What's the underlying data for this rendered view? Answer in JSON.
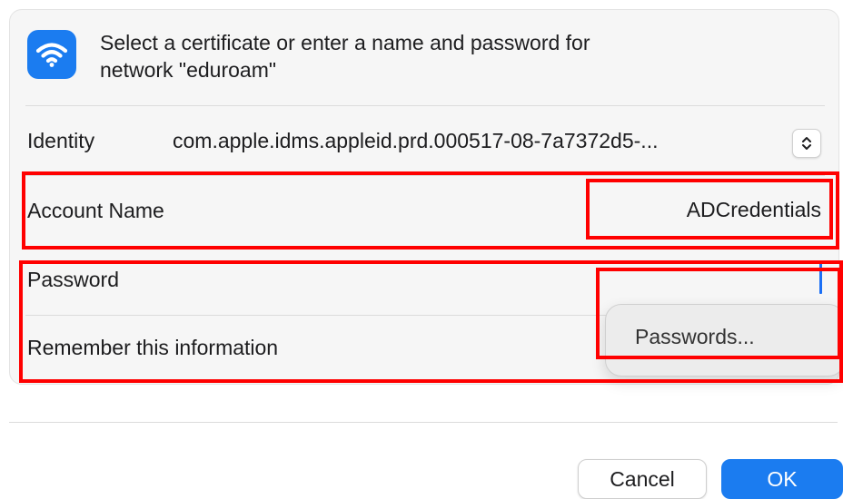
{
  "dialog": {
    "header_line1": "Select a certificate or enter a name and password for",
    "header_line2": "network \"eduroam\"",
    "icon": "wifi-icon"
  },
  "identity": {
    "label": "Identity",
    "value": "com.apple.idms.appleid.prd.000517-08-7a7372d5-...",
    "control_icon": "up-down-chevron-icon"
  },
  "account": {
    "label": "Account Name",
    "value": "ADCredentials"
  },
  "password": {
    "label": "Password",
    "value": ""
  },
  "remember": {
    "label": "Remember this information"
  },
  "autofill_popup": {
    "item": "Passwords..."
  },
  "buttons": {
    "cancel": "Cancel",
    "ok": "OK"
  },
  "colors": {
    "accent": "#1b7cf0",
    "highlight": "#ff0000",
    "panel": "#f6f6f6"
  }
}
